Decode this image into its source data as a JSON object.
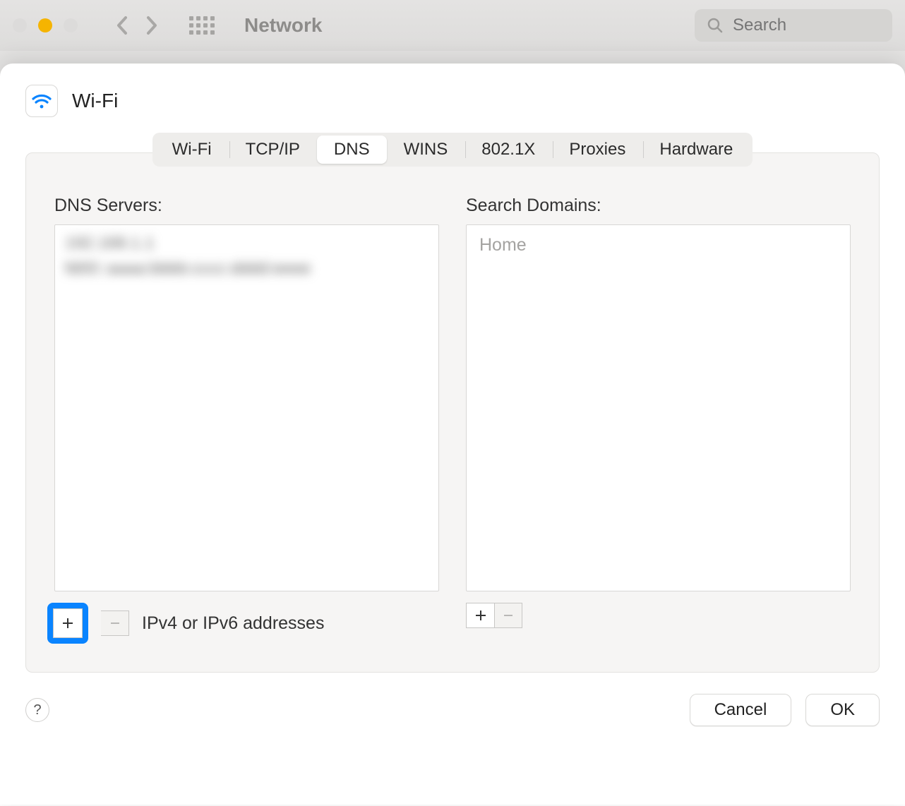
{
  "toolbar": {
    "title": "Network",
    "search_placeholder": "Search"
  },
  "sheet": {
    "title": "Wi-Fi",
    "tabs": [
      "Wi-Fi",
      "TCP/IP",
      "DNS",
      "WINS",
      "802.1X",
      "Proxies",
      "Hardware"
    ],
    "active_tab_index": 2,
    "left_label": "DNS Servers:",
    "right_label": "Search Domains:",
    "dns_servers": [
      "",
      ""
    ],
    "search_domains": [
      "Home"
    ],
    "hint": "IPv4 or IPv6 addresses",
    "cancel_label": "Cancel",
    "ok_label": "OK",
    "help_label": "?"
  }
}
